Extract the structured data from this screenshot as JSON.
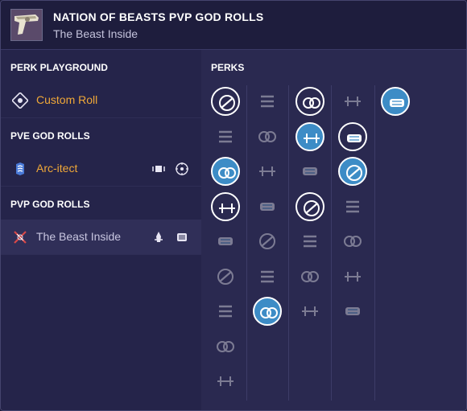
{
  "header": {
    "title": "NATION OF BEASTS PVP GOD ROLLS",
    "subtitle": "The Beast Inside"
  },
  "sidebar": {
    "sections": [
      {
        "title": "PERK PLAYGROUND"
      },
      {
        "title": "PVE GOD ROLLS"
      },
      {
        "title": "PVP GOD ROLLS"
      }
    ],
    "rolls": [
      {
        "label": "Custom Roll",
        "color": "#f0a838",
        "icon": "target-icon"
      },
      {
        "label": "Arc-itect",
        "color": "#f0a838",
        "icon": "chevron-stack-icon"
      },
      {
        "label": "The Beast Inside",
        "color": "#c8c6e0",
        "icon": "crossed-icon"
      }
    ]
  },
  "perks": {
    "title": "PERKS",
    "columns": [
      {
        "name": "barrels",
        "items": [
          {
            "icon": "smallbore-icon",
            "state": "ring"
          },
          {
            "icon": "arrowhead-brake-icon",
            "state": "dim"
          },
          {
            "icon": "hammer-forged-rifling-icon",
            "state": "selected"
          },
          {
            "icon": "chambered-compensator-icon",
            "state": "ring"
          },
          {
            "icon": "corkscrew-rifling-icon",
            "state": "dim"
          },
          {
            "icon": "extended-barrel-icon",
            "state": "dim"
          },
          {
            "icon": "fluted-barrel-icon",
            "state": "dim"
          },
          {
            "icon": "full-bore-icon",
            "state": "dim"
          },
          {
            "icon": "polygonal-rifling-icon",
            "state": "dim"
          }
        ]
      },
      {
        "name": "magazines",
        "items": [
          {
            "icon": "tactical-mag-icon",
            "state": "dim"
          },
          {
            "icon": "appended-mag-icon",
            "state": "dim"
          },
          {
            "icon": "accurized-rounds-icon",
            "state": "dim"
          },
          {
            "icon": "flared-magwell-icon",
            "state": "dim"
          },
          {
            "icon": "extended-mag-icon",
            "state": "dim"
          },
          {
            "icon": "ricochet-rounds-icon",
            "state": "dim"
          },
          {
            "icon": "high-caliber-rounds-icon",
            "state": "selected"
          }
        ]
      },
      {
        "name": "trait-1",
        "items": [
          {
            "icon": "dual-loader-icon",
            "state": "ring"
          },
          {
            "icon": "perpetual-motion-icon",
            "state": "selected"
          },
          {
            "icon": "eye-of-the-storm-icon",
            "state": "dim"
          },
          {
            "icon": "moving-target-icon",
            "state": "ring"
          },
          {
            "icon": "sunburst-icon",
            "state": "dim"
          },
          {
            "icon": "skull-icon",
            "state": "dim"
          },
          {
            "icon": "spiral-icon",
            "state": "dim"
          }
        ]
      },
      {
        "name": "trait-2",
        "items": [
          {
            "icon": "slide-shot-icon",
            "state": "dim"
          },
          {
            "icon": "no-entry-icon",
            "state": "ring"
          },
          {
            "icon": "adrenaline-icon",
            "state": "selected"
          },
          {
            "icon": "triangle-icon",
            "state": "dim"
          },
          {
            "icon": "arrow-up-icon",
            "state": "dim"
          },
          {
            "icon": "star-burst-icon",
            "state": "dim"
          },
          {
            "icon": "reticle-icon",
            "state": "dim"
          }
        ]
      },
      {
        "name": "masterwork",
        "items": [
          {
            "icon": "range-masterwork-icon",
            "state": "selected"
          }
        ]
      }
    ]
  }
}
